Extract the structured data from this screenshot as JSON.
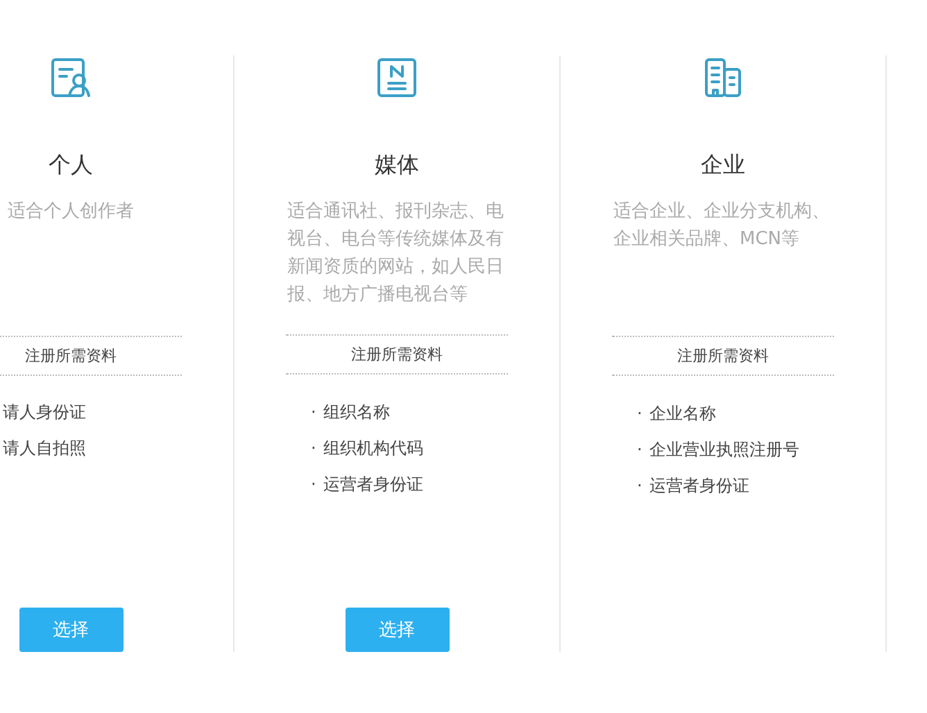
{
  "cards": [
    {
      "kind": "person-document",
      "title": "个人",
      "description": "适合个人创作者",
      "requirements_label": "注册所需资料",
      "items": [
        {
          "text": "请人身份证"
        },
        {
          "text": "请人自拍照"
        }
      ],
      "button": "选择"
    },
    {
      "kind": "newspaper",
      "title": "媒体",
      "description": "适合通讯社、报刊杂志、电视台、电台等传统媒体及有新闻资质的网站，如人民日报、地方广播电视台等",
      "requirements_label": "注册所需资料",
      "items": [
        {
          "bullet": "·",
          "text": "组织名称"
        },
        {
          "bullet": "·",
          "text": "组织机构代码"
        },
        {
          "bullet": "·",
          "text": "运营者身份证"
        }
      ],
      "button": "选择"
    },
    {
      "kind": "building",
      "title": "企业",
      "description": "适合企业、企业分支机构、企业相关品牌、MCN等",
      "requirements_label": "注册所需资料",
      "items": [
        {
          "bullet": "·",
          "text": "企业名称"
        },
        {
          "bullet": "·",
          "text": "企业营业执照注册号"
        },
        {
          "bullet": "·",
          "text": "运营者身份证"
        }
      ]
    }
  ]
}
